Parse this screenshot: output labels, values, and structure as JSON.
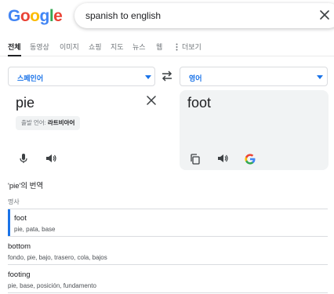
{
  "logo": {
    "letters": [
      "G",
      "o",
      "o",
      "g",
      "l",
      "e"
    ]
  },
  "search": {
    "query": "spanish to english"
  },
  "tabs": [
    {
      "label": "전체"
    },
    {
      "label": "동영상"
    },
    {
      "label": "이미지"
    },
    {
      "label": "쇼핑"
    },
    {
      "label": "지도"
    },
    {
      "label": "뉴스"
    },
    {
      "label": "웹"
    },
    {
      "label": "더보기"
    }
  ],
  "translator": {
    "source_language": "스페인어",
    "target_language": "영어",
    "source_text": "pie",
    "detected_prefix": "출발 언어:",
    "detected_language": "라트비아어",
    "target_text": "foot"
  },
  "results": {
    "title": "'pie'의 번역",
    "part_of_speech": "명사",
    "entries": [
      {
        "word": "foot",
        "synonyms": "pie, pata, base"
      },
      {
        "word": "bottom",
        "synonyms": "fondo, pie, bajo, trasero, cola, bajos"
      },
      {
        "word": "footing",
        "synonyms": "pie, base, posición, fundamento"
      }
    ]
  },
  "colors": {
    "accent": "#1a73e8",
    "panel": "#f1f3f4"
  }
}
